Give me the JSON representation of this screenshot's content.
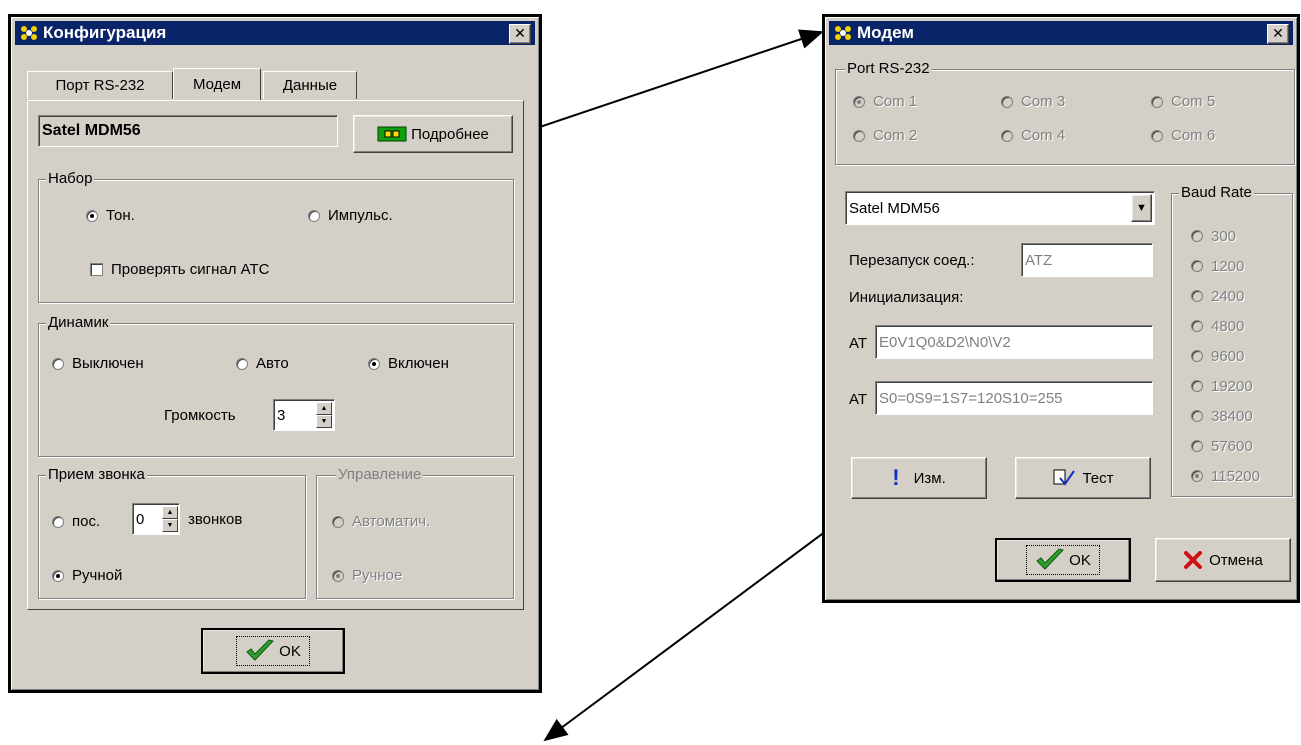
{
  "config_window": {
    "title": "Конфигурация",
    "close_glyph": "✕",
    "tabs": [
      "Порт RS-232",
      "Модем",
      "Данные"
    ],
    "modem_name": "Satel MDM56",
    "details_button": "Подробнее",
    "dial_group": {
      "label": "Набор",
      "tone": "Тон.",
      "pulse": "Импульс.",
      "check_dial_tone": "Проверять сигнал АТС"
    },
    "speaker_group": {
      "label": "Динамик",
      "off": "Выключен",
      "auto": "Авто",
      "on": "Включен",
      "volume_label": "Громкость",
      "volume_value": "3"
    },
    "answer_group": {
      "label": "Прием звонка",
      "after": "пос.",
      "rings_value": "0",
      "rings": "звонков",
      "manual": "Ручной"
    },
    "control_group": {
      "label": "Управление",
      "automatic": "Автоматич.",
      "manual": "Ручное"
    },
    "ok_button": "OK"
  },
  "modem_window": {
    "title": "Модем",
    "close_glyph": "✕",
    "port_group": {
      "label": "Port RS-232",
      "ports": [
        "Com 1",
        "Com 3",
        "Com 5",
        "Com 2",
        "Com 4",
        "Com 6"
      ]
    },
    "modem_select": "Satel MDM56",
    "reset_label": "Перезапуск соед.:",
    "reset_value": "ATZ",
    "init_label": "Инициализация:",
    "at_prefix_1": "AT",
    "init_value_1": "E0V1Q0&D2\\N0\\V2",
    "at_prefix_2": "AT",
    "init_value_2": "S0=0S9=1S7=120S10=255",
    "edit_button": "Изм.",
    "test_button": "Тест",
    "baud_group": {
      "label": "Baud Rate",
      "rates": [
        "300",
        "1200",
        "2400",
        "4800",
        "9600",
        "19200",
        "38400",
        "57600",
        "115200"
      ]
    },
    "ok_button": "OK",
    "cancel_button": "Отмена"
  },
  "colors": {
    "titlebar": "#0a246a",
    "face": "#d4d0c8",
    "ok_check": "#2e9e2e",
    "cancel_x": "#d01010"
  }
}
